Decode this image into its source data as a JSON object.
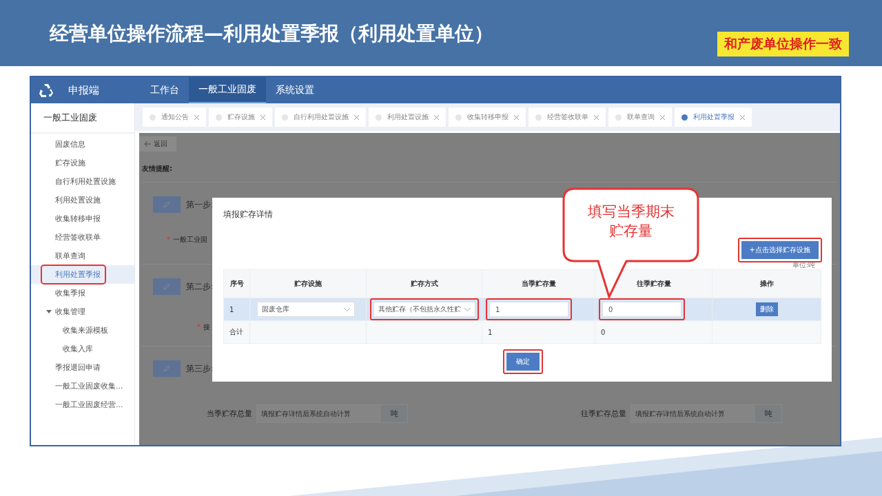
{
  "slide": {
    "title": "经营单位操作流程—利用处置季报（利用处置单位）",
    "badge": "和产废单位操作一致"
  },
  "app": {
    "brand": "申报端",
    "nav": [
      {
        "label": "工作台",
        "selected": false
      },
      {
        "label": "一般工业固废",
        "selected": true
      },
      {
        "label": "系统设置",
        "selected": false
      }
    ]
  },
  "sidebar": {
    "title": "一般工业固废",
    "items": [
      {
        "label": "固废信息",
        "selected": false,
        "highlighted": false
      },
      {
        "label": "贮存设施",
        "selected": false,
        "highlighted": false
      },
      {
        "label": "自行利用处置设施",
        "selected": false,
        "highlighted": false
      },
      {
        "label": "利用处置设施",
        "selected": false,
        "highlighted": false
      },
      {
        "label": "收集转移申报",
        "selected": false,
        "highlighted": false
      },
      {
        "label": "经营签收联单",
        "selected": false,
        "highlighted": false
      },
      {
        "label": "联单查询",
        "selected": false,
        "highlighted": false
      },
      {
        "label": "利用处置季报",
        "selected": true,
        "highlighted": true
      },
      {
        "label": "收集季报",
        "selected": false,
        "highlighted": false
      },
      {
        "label": "收集管理",
        "selected": false,
        "highlighted": false,
        "expanded": true,
        "children": [
          {
            "label": "收集来源模板",
            "selected": false,
            "highlighted": false
          },
          {
            "label": "收集入库",
            "selected": false,
            "highlighted": false
          }
        ]
      },
      {
        "label": "季报退回申请",
        "selected": false,
        "highlighted": false
      },
      {
        "label": "一般工业固废收集...",
        "selected": false,
        "highlighted": false
      },
      {
        "label": "一般工业固废经营...",
        "selected": false,
        "highlighted": false
      }
    ]
  },
  "tabs": [
    {
      "label": "通知公告",
      "selected": false
    },
    {
      "label": "贮存设施",
      "selected": false
    },
    {
      "label": "自行利用处置设施",
      "selected": false
    },
    {
      "label": "利用处置设施",
      "selected": false
    },
    {
      "label": "收集转移申报",
      "selected": false
    },
    {
      "label": "经营签收联单",
      "selected": false
    },
    {
      "label": "联单查询",
      "selected": false
    },
    {
      "label": "利用处置季报",
      "selected": true
    }
  ],
  "page": {
    "back": "返回",
    "notice": "友情提醒:",
    "steps": [
      {
        "label": "第一步:",
        "required_mark": "*",
        "field": "一般工业固"
      },
      {
        "label": "第二步:",
        "required_mark": "*",
        "field": "接"
      },
      {
        "label": "第三步:"
      }
    ],
    "totals": [
      {
        "label": "当季贮存总量",
        "placeholder": "填报贮存详情后系统自动计算",
        "unit": "吨"
      },
      {
        "label": "往季贮存总量",
        "placeholder": "填报贮存详情后系统自动计算",
        "unit": "吨"
      }
    ]
  },
  "dialog": {
    "title": "填报贮存详情",
    "add_button": {
      "label": "+点击选择贮存设施",
      "highlighted": true
    },
    "unit": "单位:吨",
    "columns": [
      "序号",
      "贮存设施",
      "贮存方式",
      "当季贮存量",
      "往季贮存量",
      "操作"
    ],
    "rows": [
      {
        "cells": [
          {
            "kind": "text",
            "value": "1"
          },
          {
            "kind": "select",
            "value": "固废仓库",
            "highlighted": false
          },
          {
            "kind": "select",
            "value": "其他贮存（不包括永久性贮",
            "highlighted": true
          },
          {
            "kind": "input",
            "value": "1",
            "highlighted": true
          },
          {
            "kind": "input",
            "value": "0",
            "highlighted": true
          },
          {
            "kind": "button",
            "value": "删除"
          }
        ]
      }
    ],
    "total": {
      "label": "合计",
      "current": "1",
      "previous": "0"
    },
    "confirm": {
      "label": "确定",
      "highlighted": true
    }
  },
  "callout": [
    "填写当季期末",
    "贮存量"
  ]
}
